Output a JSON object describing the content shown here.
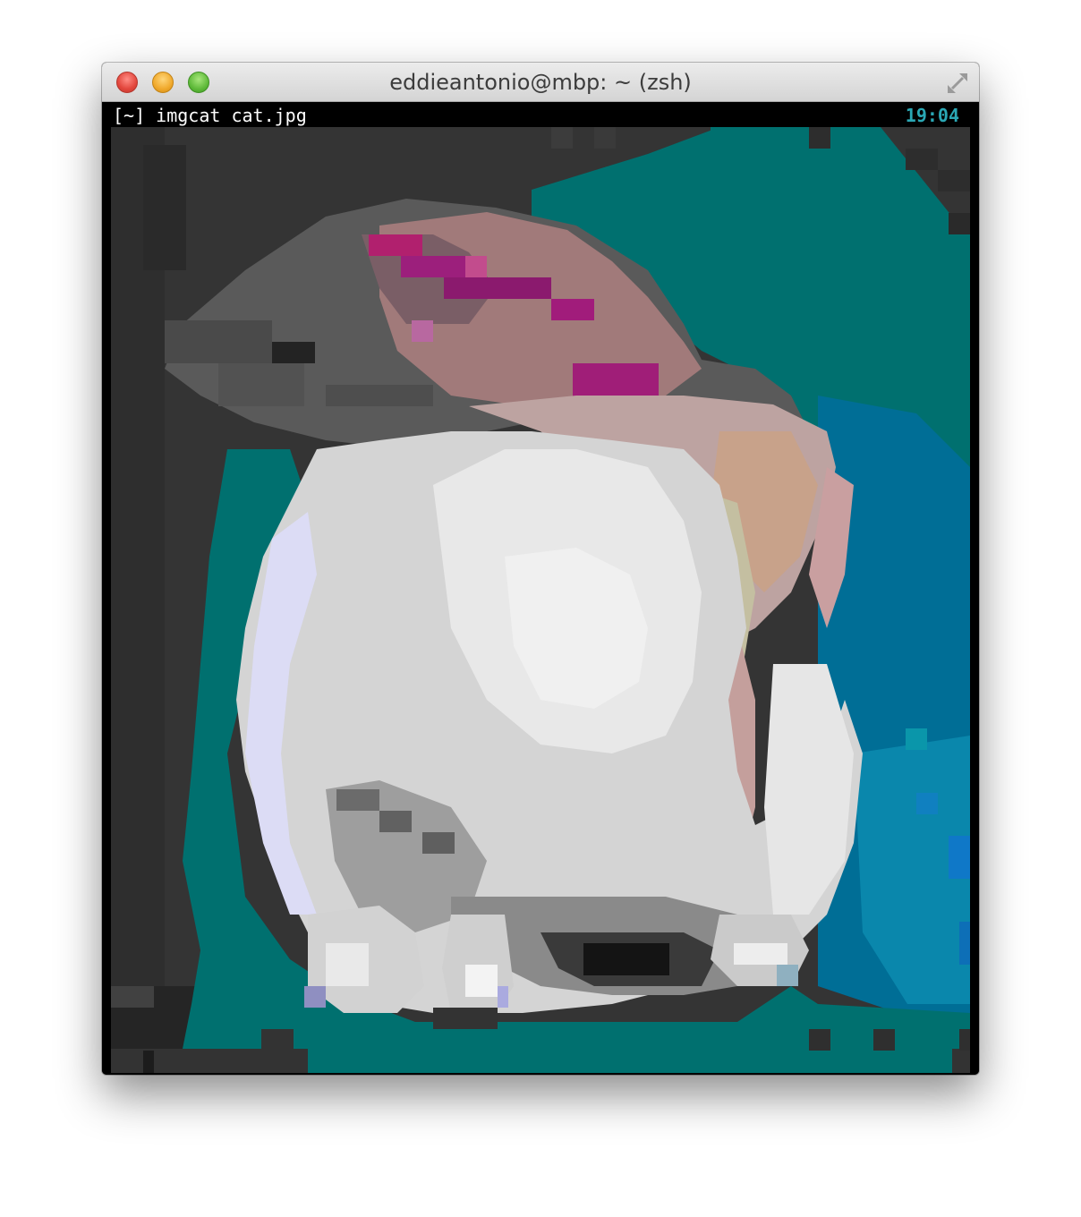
{
  "window": {
    "title": "eddieantonio@mbp: ~ (zsh)",
    "buttons": {
      "close": "close-button",
      "minimize": "minimize-button",
      "zoom": "zoom-button",
      "fullscreen": "fullscreen-arrows-icon"
    }
  },
  "terminal": {
    "prompt_dir": "[~]",
    "command": "imgcat cat.jpg",
    "clock": "19:04"
  },
  "colors": {
    "window_bg": "#000000",
    "clock": "#2aa7b4",
    "teal": "#00706f",
    "blue": "#006e96",
    "dark_gray": "#333333",
    "magenta": "#a01e78"
  },
  "output_image": {
    "description_name": "pixelated-cat-photo"
  }
}
